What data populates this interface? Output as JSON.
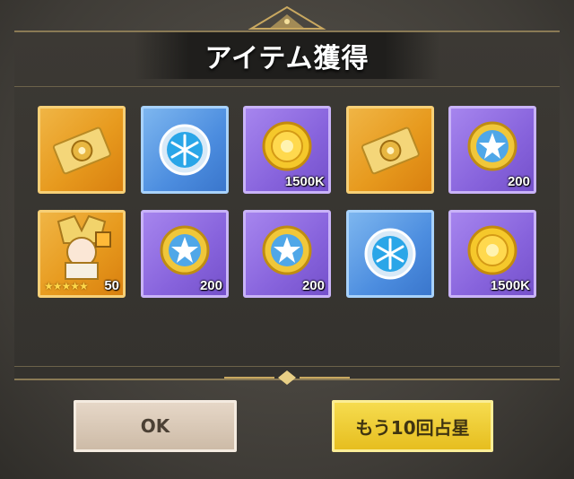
{
  "dialog": {
    "title": "アイテム獲得"
  },
  "items": [
    {
      "name": "gold-ticket",
      "rarity": "gold",
      "icon": "ticket-icon",
      "qty": ""
    },
    {
      "name": "blue-snow-orb",
      "rarity": "blue",
      "icon": "snowflake-orb-icon",
      "qty": ""
    },
    {
      "name": "gold-coin",
      "rarity": "purple",
      "icon": "sun-coin-icon",
      "qty": "1500K"
    },
    {
      "name": "gold-ticket",
      "rarity": "gold",
      "icon": "ticket-icon",
      "qty": ""
    },
    {
      "name": "star-medal",
      "rarity": "purple",
      "icon": "star-medal-icon",
      "qty": "200"
    },
    {
      "name": "hero-portrait",
      "rarity": "gold",
      "icon": "hero-portrait-icon",
      "qty": "50",
      "stars": "★★★★★"
    },
    {
      "name": "star-medal",
      "rarity": "purple",
      "icon": "star-medal-icon",
      "qty": "200"
    },
    {
      "name": "star-medal",
      "rarity": "purple",
      "icon": "star-medal-icon",
      "qty": "200"
    },
    {
      "name": "blue-snow-orb",
      "rarity": "blue",
      "icon": "snowflake-orb-icon",
      "qty": ""
    },
    {
      "name": "gold-coin",
      "rarity": "purple",
      "icon": "sun-coin-icon",
      "qty": "1500K"
    }
  ],
  "buttons": {
    "ok_label": "OK",
    "again_label": "もう10回占星"
  },
  "colors": {
    "gold_frame": "#e79a1e",
    "blue_frame": "#4c8ddf",
    "purple_frame": "#8763dc",
    "ok_button": "#d9c8b5",
    "again_button": "#f0cd35"
  }
}
